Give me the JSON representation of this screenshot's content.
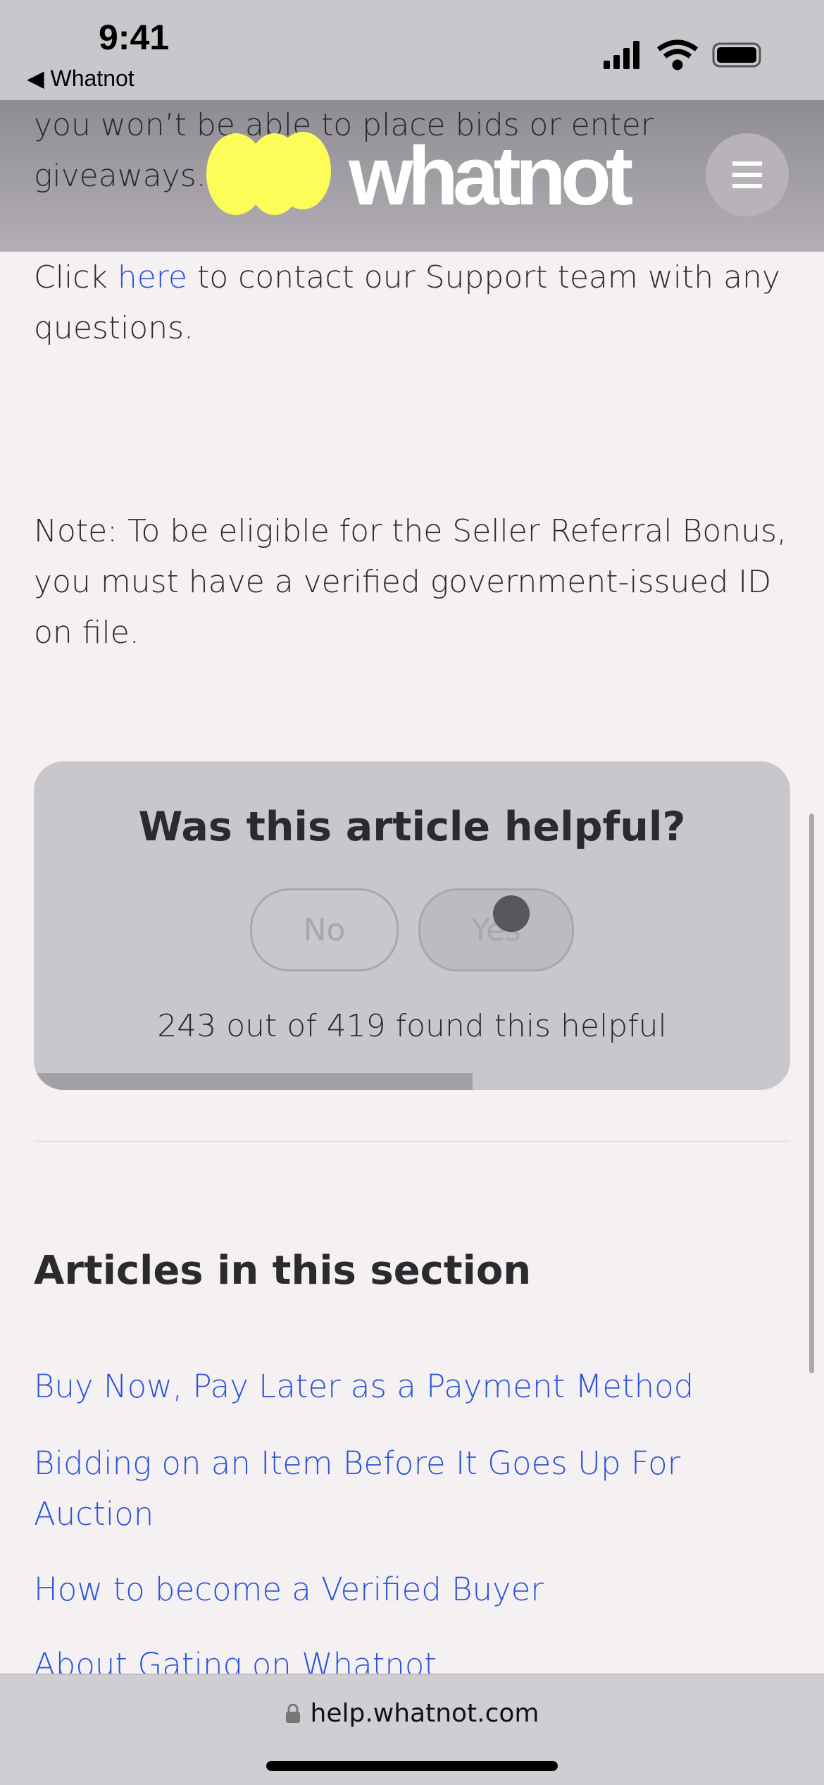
{
  "status_bar": {
    "time": "9:41",
    "back_label": "Whatnot"
  },
  "header": {
    "logo_text": "whatnot",
    "logo_color": "#fdfd5a",
    "menu_icon": "hamburger-icon"
  },
  "article": {
    "prev_line1": "you won’t be able to place bids or enter",
    "prev_line2": "giveaways.",
    "contact_pre": "Click ",
    "contact_link": "here",
    "contact_post": " to contact our Support team with any questions.",
    "note": "Note: To be eligible for the Seller Referral Bonus, you must have a verified government-issued ID on file."
  },
  "feedback": {
    "title": "Was this article helpful?",
    "no_label": "No",
    "yes_label": "Yes",
    "count_text": "243 out of 419 found this helpful",
    "helpful_fraction": 0.58
  },
  "section": {
    "title": "Articles in this section",
    "articles": [
      "Buy Now, Pay Later as a Payment Method",
      "Bidding on an Item Before It Goes Up For Auction",
      "How to become a Verified Buyer",
      "About Gating on Whatnot"
    ]
  },
  "browser": {
    "url": "help.whatnot.com",
    "lock_icon": "lock-icon"
  },
  "colors": {
    "link": "#2b55d6",
    "background": "#f5f1f3"
  }
}
